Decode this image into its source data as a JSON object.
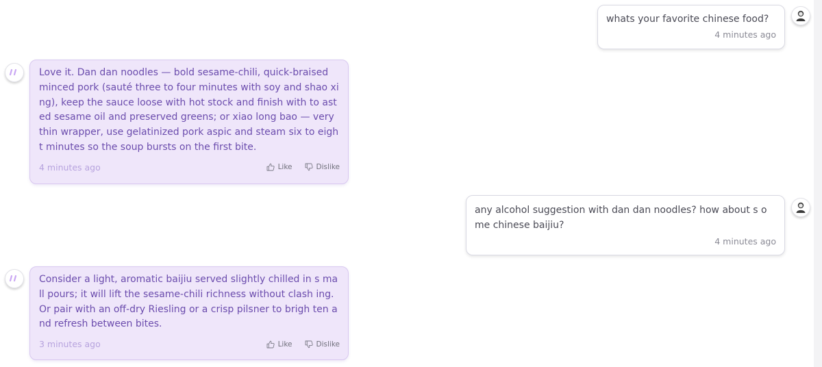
{
  "messages": [
    {
      "role": "user",
      "text": "whats your favorite chinese food?",
      "time": "4 minutes ago"
    },
    {
      "role": "assistant",
      "text": "Love it. Dan dan noodles — bold sesame-chili, quick-braised minced pork (sauté three to four minutes with soy and shao xing), keep the sauce loose with hot stock and finish with to asted sesame oil and preserved greens; or xiao long bao — very thin wrapper, use gelatinized pork aspic and steam six to eight minutes so the soup bursts on the first bite.",
      "time": "4 minutes ago",
      "like_label": "Like",
      "dislike_label": "Dislike"
    },
    {
      "role": "user",
      "text": "any alcohol suggestion with dan dan noodles? how about s ome chinese baijiu?",
      "time": "4 minutes ago"
    },
    {
      "role": "assistant",
      "text": "Consider a light, aromatic baijiu served slightly chilled in s mall pours; it will lift the sesame-chili richness without clash ing. Or pair with an off-dry Riesling or a crisp pilsner to brigh ten and refresh between bites.",
      "time": "3 minutes ago",
      "like_label": "Like",
      "dislike_label": "Dislike"
    }
  ],
  "icons": {
    "user_avatar": "user-avatar-icon",
    "bot_avatar": "bot-avatar-icon",
    "like": "thumbs-up-icon",
    "dislike": "thumbs-down-icon"
  },
  "colors": {
    "bot_bubble": "#efe6fa",
    "bot_text": "#6b4cad",
    "user_bubble": "#ffffff",
    "user_text": "#4a4a55"
  }
}
